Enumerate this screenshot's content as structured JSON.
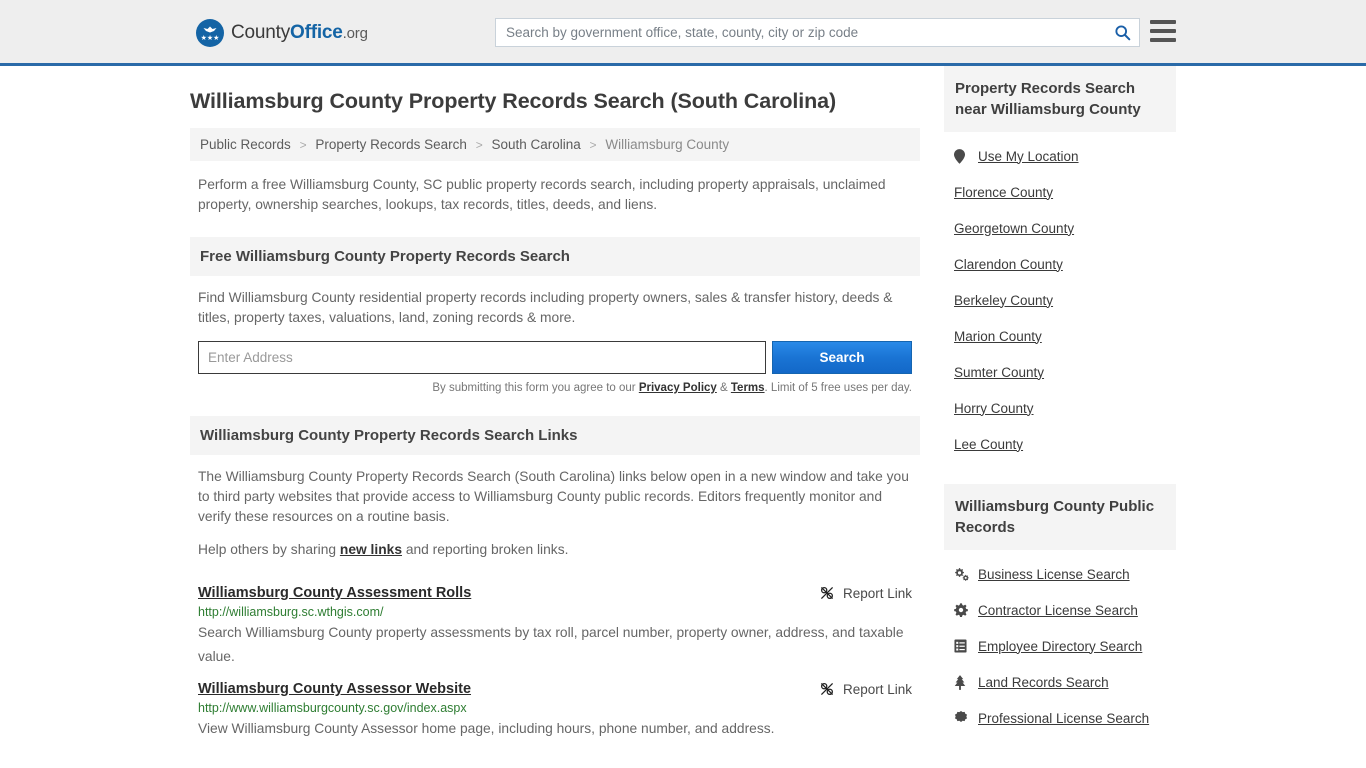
{
  "header": {
    "brand": {
      "part1": "County",
      "part2": "Office",
      "part3": ".org",
      "logo_icon": "eagle-seal-icon",
      "stars": "★★★"
    },
    "search": {
      "placeholder": "Search by government office, state, county, city or zip code",
      "value": "",
      "icon": "search-icon"
    },
    "menu": {
      "icon": "hamburger-menu-icon"
    }
  },
  "main": {
    "title": "Williamsburg County Property Records Search (South Carolina)",
    "breadcrumb": [
      {
        "label": "Public Records",
        "current": false
      },
      {
        "label": "Property Records Search",
        "current": false
      },
      {
        "label": "South Carolina",
        "current": false
      },
      {
        "label": "Williamsburg County",
        "current": true
      }
    ],
    "breadcrumb_separator": ">",
    "intro": "Perform a free Williamsburg County, SC public property records search, including property appraisals, unclaimed property, ownership searches, lookups, tax records, titles, deeds, and liens.",
    "free_search": {
      "heading": "Free Williamsburg County Property Records Search",
      "description": "Find Williamsburg County residential property records including property owners, sales & transfer history, deeds & titles, property taxes, valuations, land, zoning records & more.",
      "input_placeholder": "Enter Address",
      "input_value": "",
      "button_label": "Search",
      "note_prefix": "By submitting this form you agree to our ",
      "note_privacy": "Privacy Policy",
      "note_amp": " & ",
      "note_terms": "Terms",
      "note_suffix": ". Limit of 5 free uses per day."
    },
    "links_section": {
      "heading": "Williamsburg County Property Records Search Links",
      "paragraph1": "The Williamsburg County Property Records Search (South Carolina) links below open in a new window and take you to third party websites that provide access to Williamsburg County public records. Editors frequently monitor and verify these resources on a routine basis.",
      "help_prefix": "Help others by sharing ",
      "help_link": "new links",
      "help_suffix": " and reporting broken links.",
      "report_label": "Report Link",
      "report_icon": "broken-link-icon",
      "items": [
        {
          "title": "Williamsburg County Assessment Rolls",
          "url": "http://williamsburg.sc.wthgis.com/",
          "description": "Search Williamsburg County property assessments by tax roll, parcel number, property owner, address, and taxable value."
        },
        {
          "title": "Williamsburg County Assessor Website",
          "url": "http://www.williamsburgcounty.sc.gov/index.aspx",
          "description": "View Williamsburg County Assessor home page, including hours, phone number, and address."
        }
      ]
    }
  },
  "sidebar": {
    "nearby": {
      "heading": "Property Records Search near Williamsburg County",
      "items": [
        {
          "label": "Use My Location",
          "icon": "map-pin-icon"
        },
        {
          "label": "Florence County",
          "icon": ""
        },
        {
          "label": "Georgetown County",
          "icon": ""
        },
        {
          "label": "Clarendon County",
          "icon": ""
        },
        {
          "label": "Berkeley County",
          "icon": ""
        },
        {
          "label": "Marion County",
          "icon": ""
        },
        {
          "label": "Sumter County",
          "icon": ""
        },
        {
          "label": "Horry County",
          "icon": ""
        },
        {
          "label": "Lee County",
          "icon": ""
        }
      ]
    },
    "public_records": {
      "heading": "Williamsburg County Public Records",
      "items": [
        {
          "label": "Business License Search",
          "icon": "cogs-icon"
        },
        {
          "label": "Contractor License Search",
          "icon": "cog-icon"
        },
        {
          "label": "Employee Directory Search",
          "icon": "list-alt-icon"
        },
        {
          "label": "Land Records Search",
          "icon": "tree-icon"
        },
        {
          "label": "Professional License Search",
          "icon": "certificate-icon"
        }
      ]
    }
  },
  "colors": {
    "brand_blue": "#1464a5",
    "header_border": "#2a6aa8",
    "button_blue": "#1a74d4",
    "url_green": "#2e7d32",
    "panel_gray": "#f4f4f4"
  }
}
